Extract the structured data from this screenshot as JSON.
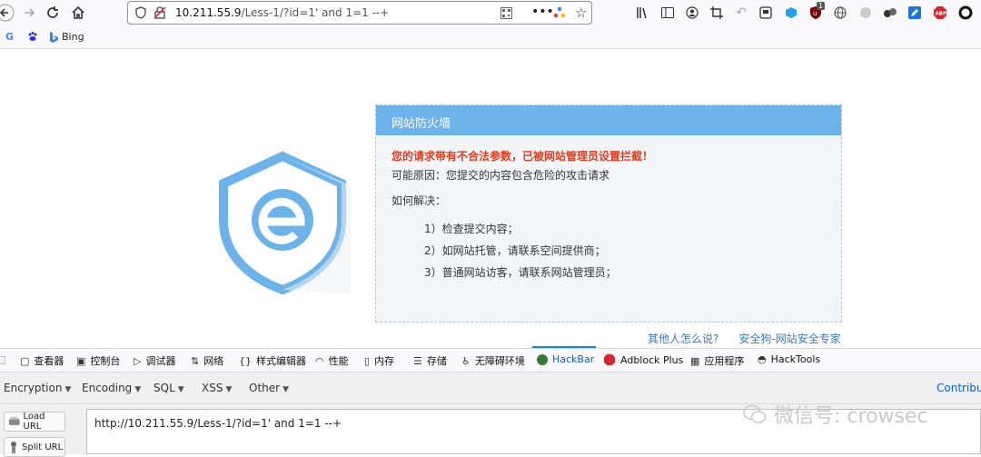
{
  "browser": {
    "url_host": "10.211.55.9",
    "url_path": "/Less-1/?id=1' and 1=1 --+",
    "bookmarks": [
      {
        "label": "G",
        "icon": "google-icon"
      },
      {
        "label": "",
        "icon": "baidu-icon"
      },
      {
        "label": "Bing",
        "icon": "bing-icon"
      }
    ],
    "badge_count": "1"
  },
  "waf": {
    "title": "网站防火墙",
    "warning": "您的请求带有不合法参数，已被网站管理员设置拦截！",
    "reason": "可能原因：您提交的内容包含危险的攻击请求",
    "howto": "如何解决：",
    "steps": [
      "1）检查提交内容；",
      "2）如网站托管，请联系空间提供商；",
      "3）普通网站访客，请联系网站管理员；"
    ],
    "link_feedback": "其他人怎么说?",
    "link_brand": "安全狗-网站安全专家"
  },
  "devtools": {
    "tabs": [
      "查看器",
      "控制台",
      "调试器",
      "网络",
      "样式编辑器",
      "性能",
      "内存",
      "存储",
      "无障碍环境",
      "HackBar",
      "Adblock Plus",
      "应用程序",
      "HackTools"
    ],
    "active_tab": "HackBar"
  },
  "hackbar": {
    "menu": [
      "Encryption",
      "Encoding",
      "SQL",
      "XSS",
      "Other"
    ],
    "contribute": "Contribut",
    "load_url": "Load URL",
    "split_url": "Split URL",
    "url_value": "http://10.211.55.9/Less-1/?id=1' and 1=1 --+"
  },
  "watermark": "微信号: crowsec",
  "colors": {
    "waf_header": "#6cb3ec",
    "waf_warning": "#e73b1a",
    "link": "#3a79c7",
    "active_tab": "#0a60d8"
  }
}
